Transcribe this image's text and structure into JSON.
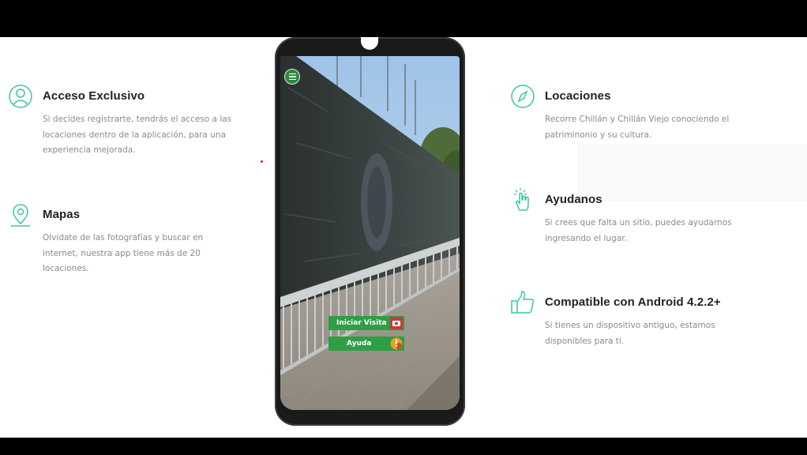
{
  "features_left": [
    {
      "title": "Acceso Exclusivo",
      "text": "Si decides registrarte, tendrás el acceso a las locaciones dentro de la aplicación, para una experiencia mejorada.",
      "icon": "user-icon"
    },
    {
      "title": "Mapas",
      "text": "Olvidate de las fotografías y buscar en internet, nuestra app tiene más de 20 locaciones.",
      "icon": "map-pin-icon"
    }
  ],
  "features_right": [
    {
      "title": "Locaciones",
      "text": "Recorre Chillán y Chillán Viejo conociendo el patriminonio y su cultura.",
      "icon": "compass-icon"
    },
    {
      "title": "Ayudanos",
      "text": "Si crees que falta un sitio, puedes ayudarnos ingresando el lugar.",
      "icon": "tap-icon"
    },
    {
      "title": "Compatible con Android 4.2.2+",
      "text": "Si tienes un dispositivo antiguo, estamos disponibles para ti.",
      "icon": "thumbs-up-icon"
    }
  ],
  "phone": {
    "buttons": {
      "start_visit": "Iniciar Visita",
      "help": "Ayuda"
    }
  },
  "colors": {
    "accent_icon": "#3cc6a0",
    "app_green": "#2f9e45"
  }
}
